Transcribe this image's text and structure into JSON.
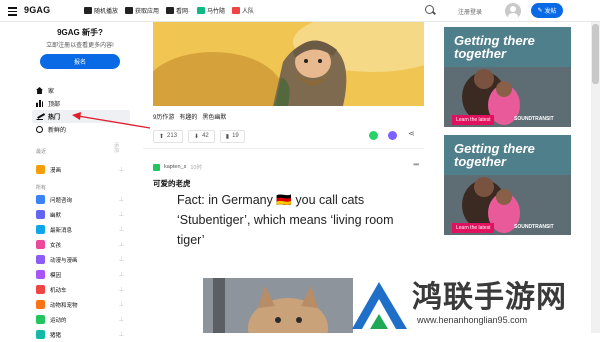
{
  "topbar": {
    "logo": "9GAG",
    "nav": [
      "随机播放",
      "获取应用",
      "看网·",
      "马竹隨",
      "人队"
    ],
    "login": "注册登录",
    "post_button": "发帖"
  },
  "sidebar": {
    "signup_title": "9GAG 新手?",
    "signup_sub": "立即注册以查看更多内容!",
    "signup_button": "报名",
    "nav": [
      {
        "label": "家",
        "icon": "home-icon"
      },
      {
        "label": "顶部",
        "icon": "chart-icon"
      },
      {
        "label": "热门",
        "icon": "trending-icon"
      },
      {
        "label": "新鲜的",
        "icon": "clock-icon"
      }
    ],
    "recent_label": "最近",
    "recent_pin": "添加",
    "recent_items": [
      {
        "label": "漫画",
        "color": "#f59e0b"
      }
    ],
    "all_label": "所有",
    "categories": [
      {
        "label": "问题咨询",
        "color": "#3b82f6"
      },
      {
        "label": "幽默",
        "color": "#6366f1"
      },
      {
        "label": "最新消息",
        "color": "#0ea5e9"
      },
      {
        "label": "女孩",
        "color": "#ec4899"
      },
      {
        "label": "动漫与漫画",
        "color": "#8b5cf6"
      },
      {
        "label": "模因",
        "color": "#a855f7"
      },
      {
        "label": "机动车",
        "color": "#ef4444"
      },
      {
        "label": "动物和宠物",
        "color": "#f97316"
      },
      {
        "label": "运动的",
        "color": "#22c55e"
      },
      {
        "label": "猪猪",
        "color": "#14b8a6"
      }
    ]
  },
  "feed": {
    "post1": {
      "tags": [
        "9历作游",
        "有趣的",
        "黑色幽默"
      ],
      "upvotes": "213",
      "downvotes": "42",
      "comments": "19"
    },
    "post2": {
      "author": "kapten_s",
      "time": "10时",
      "title": "可爱的老虎",
      "meme_text": "Fact: in Germany 🇩🇪 you call cats ‘Stubentiger’, which means ‘living room tiger’"
    }
  },
  "ads": [
    {
      "headline": "Getting there together",
      "button": "Learn the latest",
      "brand": "SOUNDTRANSIT"
    },
    {
      "headline": "Getting there together",
      "button": "Learn the latest",
      "brand": "SOUNDTRANSIT"
    }
  ],
  "watermark": {
    "title": "鸿联手游网",
    "url": "www.henanhonglian95.com"
  },
  "colors": {
    "accent": "#0a6ae6",
    "annotation_arrow": "#e11d2e"
  }
}
